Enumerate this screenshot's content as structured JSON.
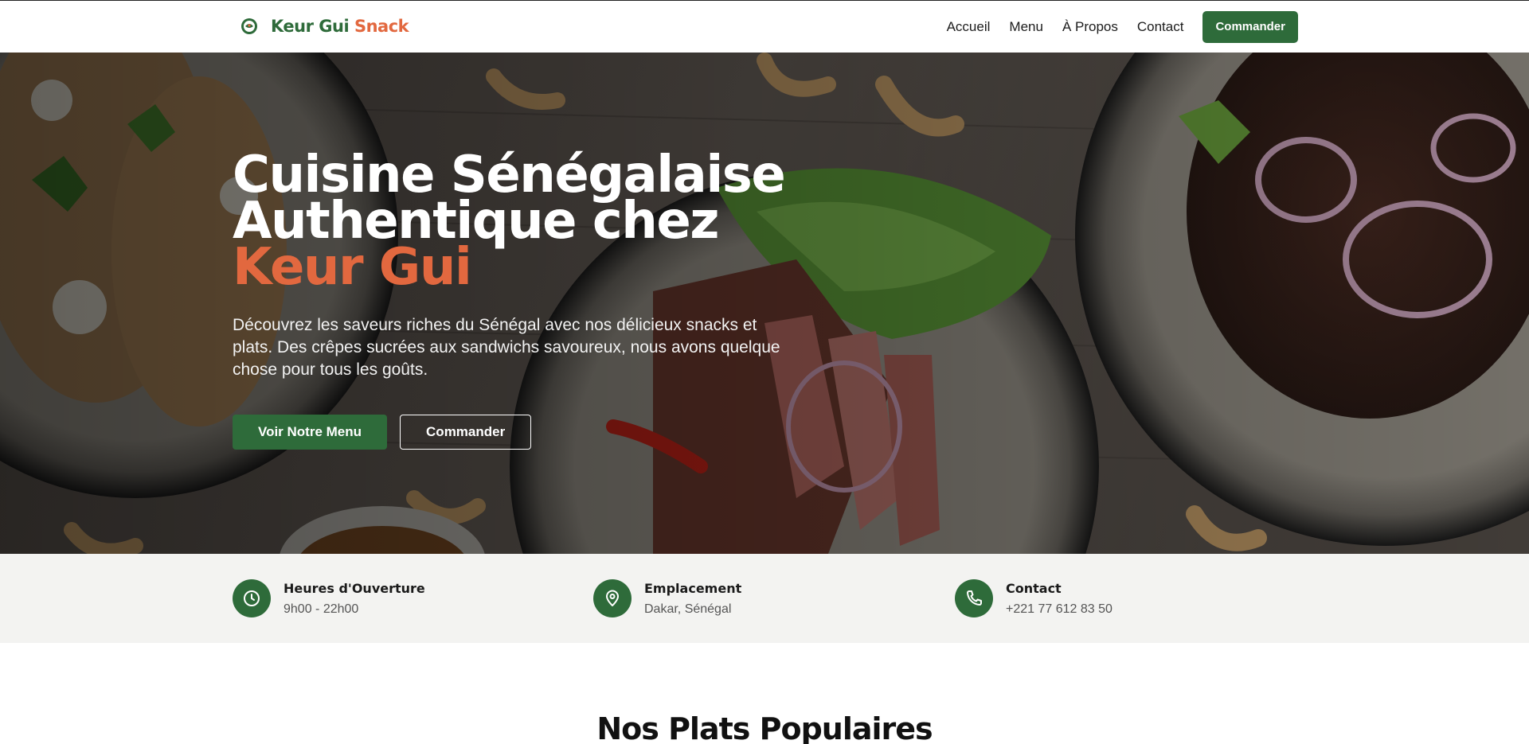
{
  "brand": {
    "name_part1": "Keur Gui",
    "name_part2": "Snack"
  },
  "nav": {
    "links": [
      "Accueil",
      "Menu",
      "À Propos",
      "Contact"
    ],
    "cta_label": "Commander"
  },
  "hero": {
    "title_line1": "Cuisine Sénégalaise",
    "title_line2": "Authentique chez",
    "title_accent": "Keur Gui",
    "description": "Découvrez les saveurs riches du Sénégal avec nos délicieux snacks et plats. Des crêpes sucrées aux sandwichs savoureux, nous avons quelque chose pour tous les goûts.",
    "primary_button": "Voir Notre Menu",
    "secondary_button": "Commander"
  },
  "info": [
    {
      "icon": "clock-icon",
      "title": "Heures d'Ouverture",
      "value": "9h00 - 22h00"
    },
    {
      "icon": "map-pin-icon",
      "title": "Emplacement",
      "value": "Dakar, Sénégal"
    },
    {
      "icon": "phone-icon",
      "title": "Contact",
      "value": "+221 77 612 83 50"
    }
  ],
  "section": {
    "title": "Nos Plats Populaires"
  },
  "colors": {
    "brand_green": "#2e6b3a",
    "accent_orange": "#e2683f",
    "info_bg": "#f3f3f1"
  }
}
